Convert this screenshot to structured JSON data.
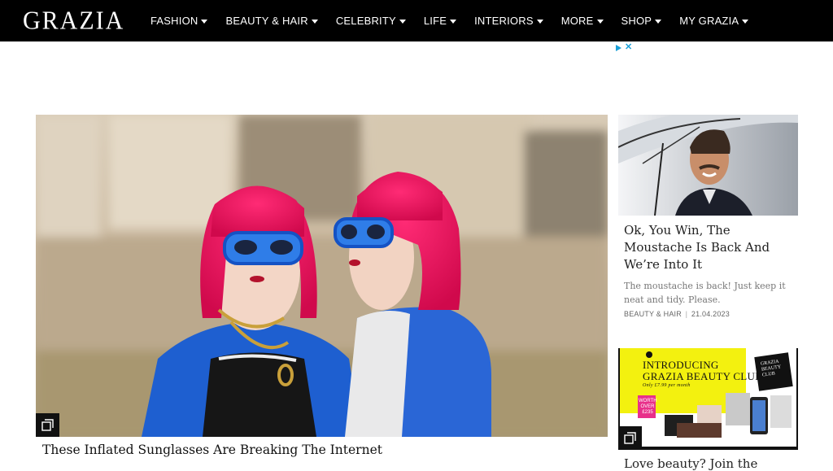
{
  "header": {
    "logo": "GRAZIA",
    "nav": [
      {
        "label": "FASHION"
      },
      {
        "label": "BEAUTY & HAIR"
      },
      {
        "label": "CELEBRITY"
      },
      {
        "label": "LIFE"
      },
      {
        "label": "INTERIORS"
      },
      {
        "label": "MORE"
      },
      {
        "label": "SHOP"
      },
      {
        "label": "MY GRAZIA"
      }
    ]
  },
  "ad": {
    "close": "✕"
  },
  "hero": {
    "title": "These Inflated Sunglasses Are Breaking The Internet",
    "badge_icon": "gallery-icon"
  },
  "side_card": {
    "title": "Ok, You Win, The Moustache Is Back And We’re Into It",
    "description": "The moustache is back! Just keep it neat and tidy. Please.",
    "category": "BEAUTY & HAIR",
    "separator": "|",
    "date": "21.04.2023"
  },
  "promo_card": {
    "headline_line1": "INTRODUCING",
    "headline_line2": "GRAZIA BEAUTY CLUB",
    "subline": "Only £7.99 per month",
    "badge_line1": "WORTH",
    "badge_line2": "OVER",
    "badge_line3": "£235",
    "mini_logo_line1": "GRAZIA",
    "mini_logo_line2": "BEAUTY",
    "mini_logo_line3": "CLUB",
    "title": "Love beauty? Join the"
  },
  "colors": {
    "topbar": "#000000",
    "promo_yellow": "#f3f10f",
    "promo_pink": "#e8308a"
  }
}
